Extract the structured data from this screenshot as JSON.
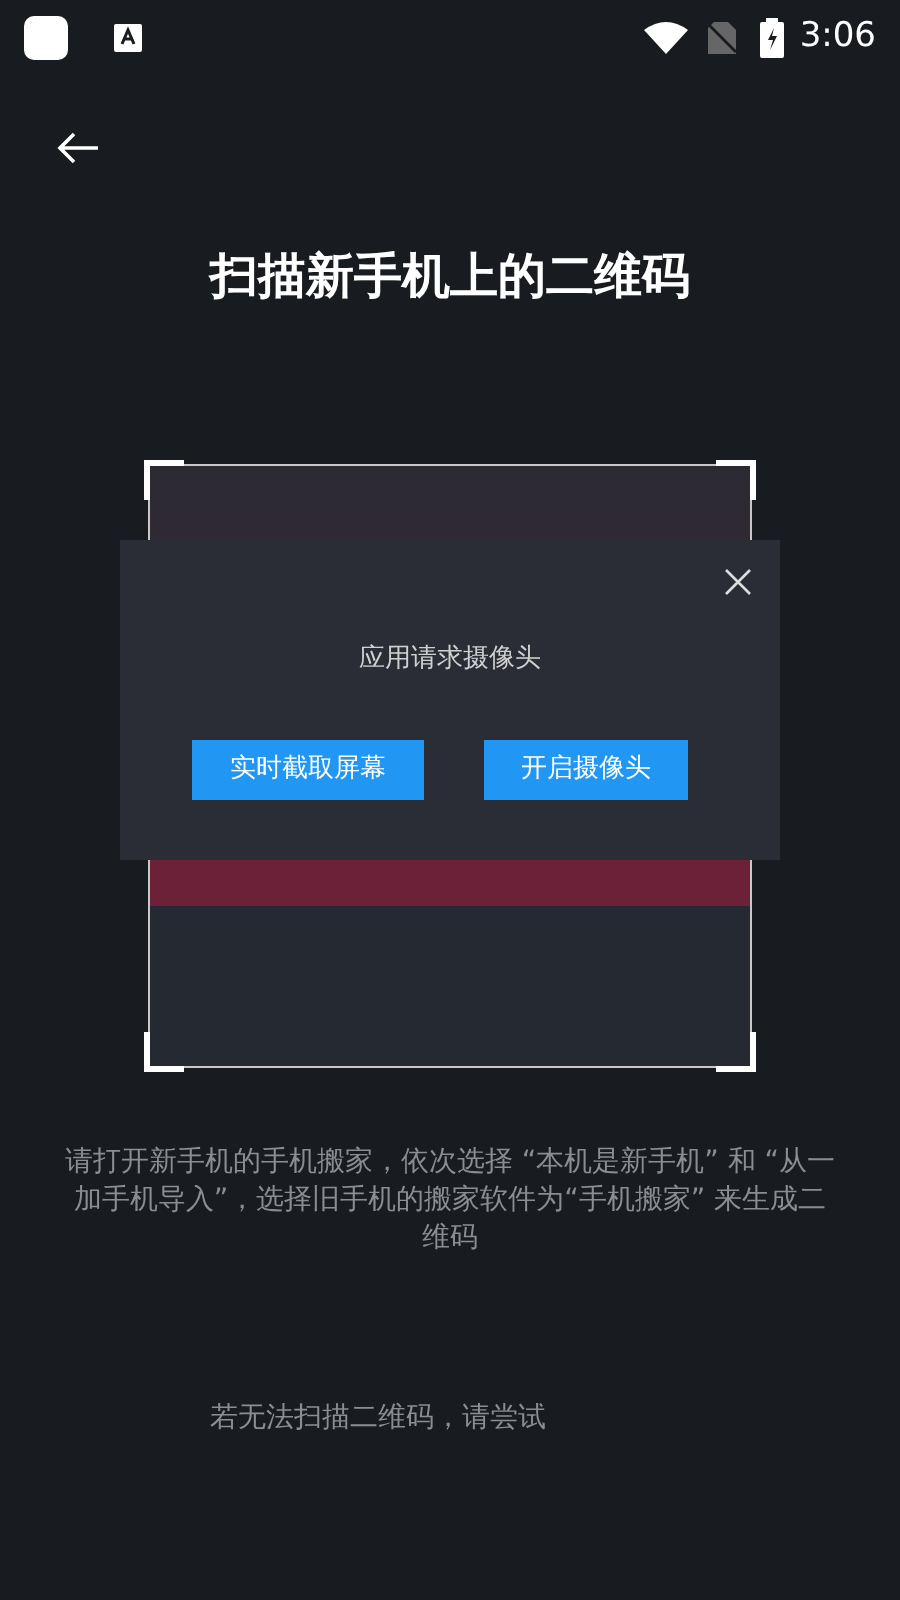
{
  "status_bar": {
    "time": "3:06"
  },
  "title": "扫描新手机上的二维码",
  "dialog": {
    "message": "应用请求摄像头",
    "buttons": [
      "实时截取屏幕",
      "开启摄像头"
    ]
  },
  "instructions": "请打开新手机的手机搬家，依次选择 “本机是新手机” 和 “从一加手机导入”，选择旧手机的搬家软件为“手机搬家” 来生成二维码",
  "footer": "若无法扫描二维码，请尝试"
}
